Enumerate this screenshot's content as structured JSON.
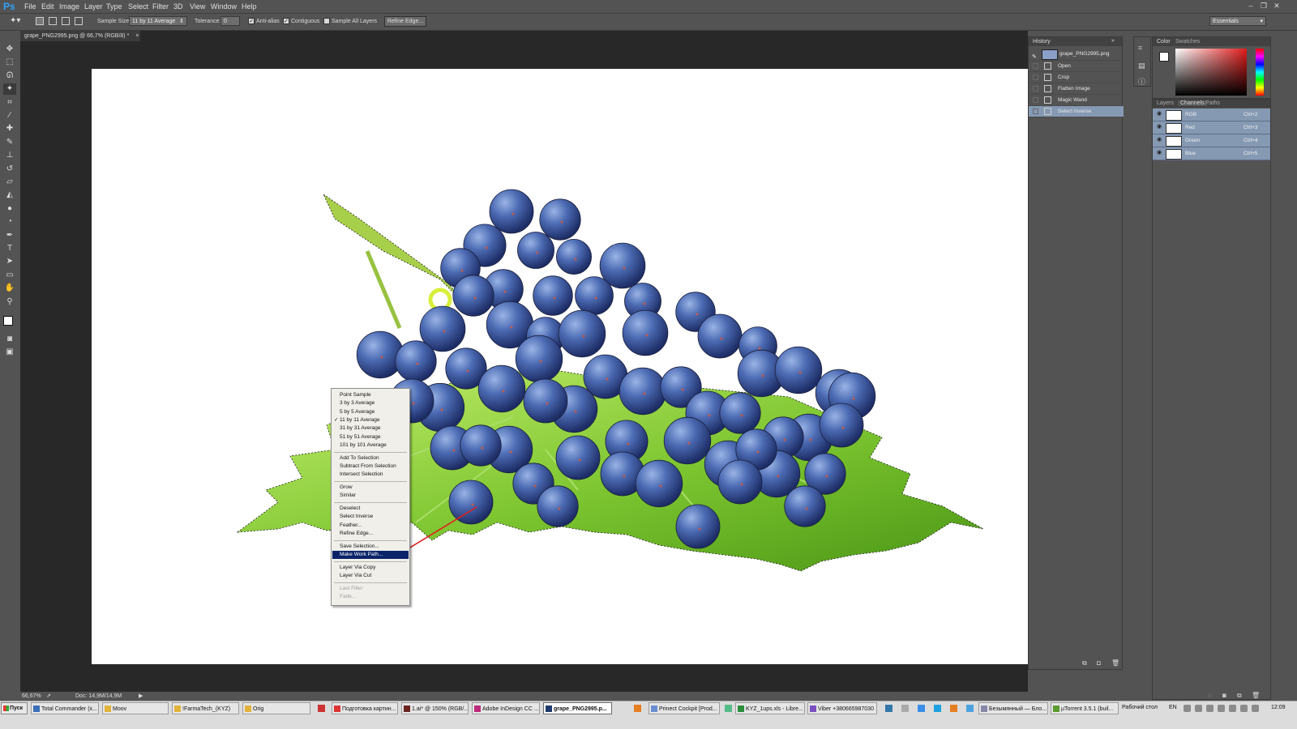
{
  "app": {
    "logo": "Ps"
  },
  "menubar": [
    "File",
    "Edit",
    "Image",
    "Layer",
    "Type",
    "Select",
    "Filter",
    "3D",
    "View",
    "Window",
    "Help"
  ],
  "options": {
    "sample_size_label": "Sample Size:",
    "sample_size_value": "11 by 11 Average",
    "tolerance_label": "Tolerance:",
    "tolerance_value": "0",
    "anti_alias": "Anti-alias",
    "contiguous": "Contiguous",
    "sample_all_layers": "Sample All Layers",
    "refine_edge": "Refine Edge...",
    "workspace": "Essentials"
  },
  "document": {
    "tab_title": "grape_PNG2995.png @ 66,7% (RGB/8) *",
    "zoom": "66,67%",
    "doc_size": "Doc: 14,9M/14,9M"
  },
  "history": {
    "title": "History",
    "snapshot": "grape_PNG2995.png",
    "steps": [
      "Open",
      "Crop",
      "Flatten Image",
      "Magic Wand",
      "Select Inverse"
    ],
    "selected_index": 4
  },
  "color_panel": {
    "tabs": [
      "Color",
      "Swatches"
    ]
  },
  "layers_panel": {
    "tabs": [
      "Layers",
      "Channels",
      "Paths"
    ],
    "channels": [
      {
        "name": "RGB",
        "shortcut": "Ctrl+2"
      },
      {
        "name": "Red",
        "shortcut": "Ctrl+3"
      },
      {
        "name": "Green",
        "shortcut": "Ctrl+4"
      },
      {
        "name": "Blue",
        "shortcut": "Ctrl+5"
      }
    ]
  },
  "context_menu": {
    "groups": [
      [
        "Point Sample",
        "3 by 3 Average",
        "5 by 5 Average",
        "11 by 11 Average",
        "31 by 31 Average",
        "51 by 51 Average",
        "101 by 101 Average"
      ],
      [
        "Add To Selection",
        "Subtract From Selection",
        "Intersect Selection"
      ],
      [
        "Grow",
        "Similar"
      ],
      [
        "Deselect",
        "Select Inverse",
        "Feather...",
        "Refine Edge..."
      ],
      [
        "Save Selection...",
        "Make Work Path..."
      ],
      [
        "Layer Via Copy",
        "Layer Via Cut"
      ],
      [
        "Last Filter",
        "Fade..."
      ]
    ],
    "checked": "11 by 11 Average",
    "highlighted": "Make Work Path...",
    "disabled": [
      "Last Filter",
      "Fade..."
    ]
  },
  "taskbar": {
    "start": "Пуск",
    "tasks": [
      "Total Commander (x...",
      "Moov",
      "!FarmaTech_(KYZ)",
      "Orig",
      "Подготовка картин...",
      "1.ai* @ 150% (RGB/...",
      "Adobe InDesign CC ...",
      "grape_PNG2995.p...",
      "Prinect Cockpit [Prod...",
      "KYZ_1ups.xls - Libre...",
      "Viber +380665987030",
      "Безымянный — Бло...",
      "µTorrent 3.5.1 (buil..."
    ],
    "active_task": "grape_PNG2995.p...",
    "tray_label": "Рабочий стол",
    "lang": "EN",
    "clock": "12:09"
  },
  "colors": {
    "ui_bg": "#535353",
    "doc_bg": "#282828",
    "selection_blue": "#8599b3",
    "menu_highlight": "#0a246a",
    "arrow_red": "#e02020"
  }
}
